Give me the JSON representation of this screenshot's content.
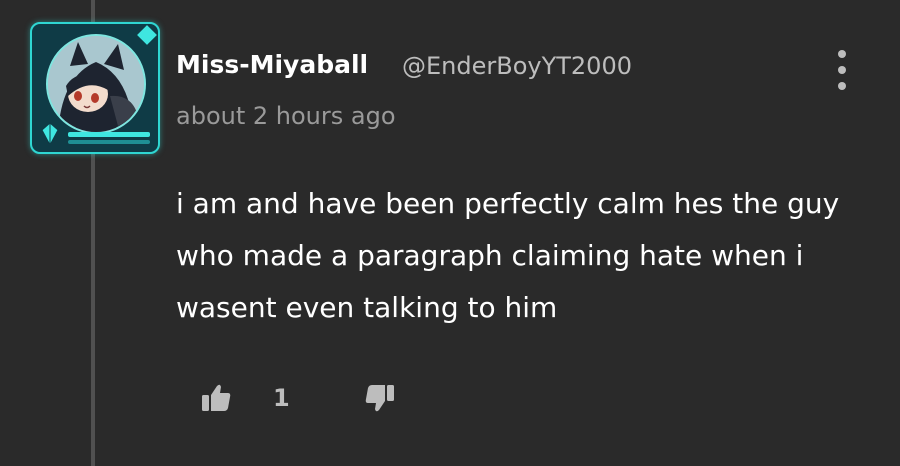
{
  "comment": {
    "username": "Miss-Miyaball",
    "handle": "@EnderBoyYT2000",
    "timestamp": "about 2 hours ago",
    "body": "i am and have been perfectly calm hes the guy who made a paragraph claiming hate when i wasent even talking to him",
    "like_count": "1",
    "icons": {
      "more": "more-vertical-icon",
      "like": "thumbs-up-icon",
      "dislike": "thumbs-down-icon"
    }
  },
  "colors": {
    "background": "#2a2a2a",
    "avatar_frame_accent": "#2fd6d2",
    "secondary_text": "#bdbdbd",
    "timestamp_text": "#9a9a9a"
  }
}
